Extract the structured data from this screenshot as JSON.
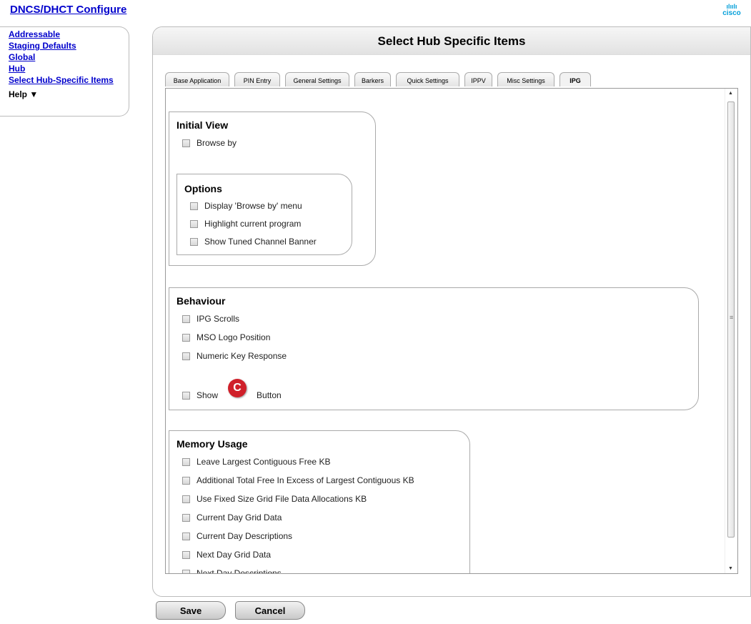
{
  "header": {
    "title_part1": "DNCS",
    "title_sep": "/",
    "title_part2": "DHCT Configure",
    "logo_word": "cisco",
    "logo_bars": "ılıılı"
  },
  "sidebar": {
    "items": [
      {
        "label": "Addressable"
      },
      {
        "label": "Staging Defaults"
      },
      {
        "label": "Global"
      },
      {
        "label": "Hub"
      },
      {
        "label": "Select Hub-Specific Items"
      }
    ],
    "help": "Help ▼"
  },
  "main": {
    "title": "Select Hub Specific Items"
  },
  "tabs": [
    {
      "label": "Base Application"
    },
    {
      "label": "PIN Entry"
    },
    {
      "label": "General Settings"
    },
    {
      "label": "Barkers"
    },
    {
      "label": "Quick Settings"
    },
    {
      "label": "IPPV"
    },
    {
      "label": "Misc Settings"
    },
    {
      "label": "IPG"
    }
  ],
  "active_tab": "IPG",
  "sections": {
    "initial_view": {
      "title": "Initial View",
      "browse_by": "Browse by"
    },
    "options": {
      "title": "Options",
      "items": [
        "Display 'Browse by' menu",
        "Highlight current program",
        "Show Tuned Channel Banner"
      ]
    },
    "behaviour": {
      "title": "Behaviour",
      "items": [
        "IPG Scrolls",
        "MSO Logo Position",
        "Numeric Key Response"
      ],
      "show_label": "Show",
      "show_icon": "C",
      "button_label": "Button"
    },
    "memory": {
      "title": "Memory Usage",
      "items": [
        "Leave Largest Contiguous Free KB",
        "Additional Total Free In Excess of Largest Contiguous KB",
        "Use Fixed Size Grid File Data Allocations KB",
        "Current Day Grid Data",
        "Current Day Descriptions",
        "Next Day Grid Data",
        "Next Day Descriptions"
      ]
    }
  },
  "buttons": {
    "save": "Save",
    "cancel": "Cancel"
  }
}
